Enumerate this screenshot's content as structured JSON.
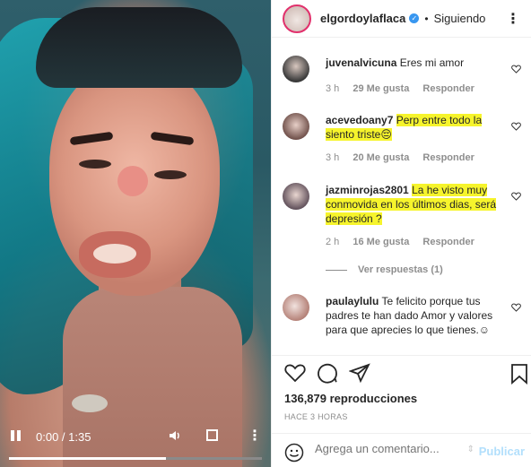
{
  "video": {
    "time": "0:00 / 1:35",
    "progress_fraction": 0.62
  },
  "header": {
    "username": "elgordoylaflaca",
    "separator": "•",
    "follow_label": "Siguiendo"
  },
  "comments": [
    {
      "user": "juvenalvicuna",
      "text": "Eres mi amor",
      "age": "3 h",
      "likes": "29 Me gusta",
      "reply_label": "Responder",
      "highlighted": false
    },
    {
      "user": "acevedoany7",
      "text": "Perp entre todo la siento triste😔",
      "age": "3 h",
      "likes": "20 Me gusta",
      "reply_label": "Responder",
      "highlighted": true
    },
    {
      "user": "jazminrojas2801",
      "text": "La he visto muy conmovida en los últimos dias, será depresión ?",
      "age": "2 h",
      "likes": "16 Me gusta",
      "reply_label": "Responder",
      "highlighted": true,
      "replies_label": "Ver respuestas (1)"
    },
    {
      "user": "paulaylulu",
      "text": "Te felicito porque tus padres te han dado Amor y valores para que aprecies lo que tienes.☺",
      "highlighted": false
    }
  ],
  "stats": {
    "views": "136,879 reproducciones",
    "ago": "HACE 3 HORAS"
  },
  "composer": {
    "placeholder": "Agrega un comentario...",
    "publish_label": "Publicar"
  },
  "colors": {
    "highlight": "#f6f42c",
    "verified": "#3897f0",
    "publish": "#b2dffc"
  }
}
